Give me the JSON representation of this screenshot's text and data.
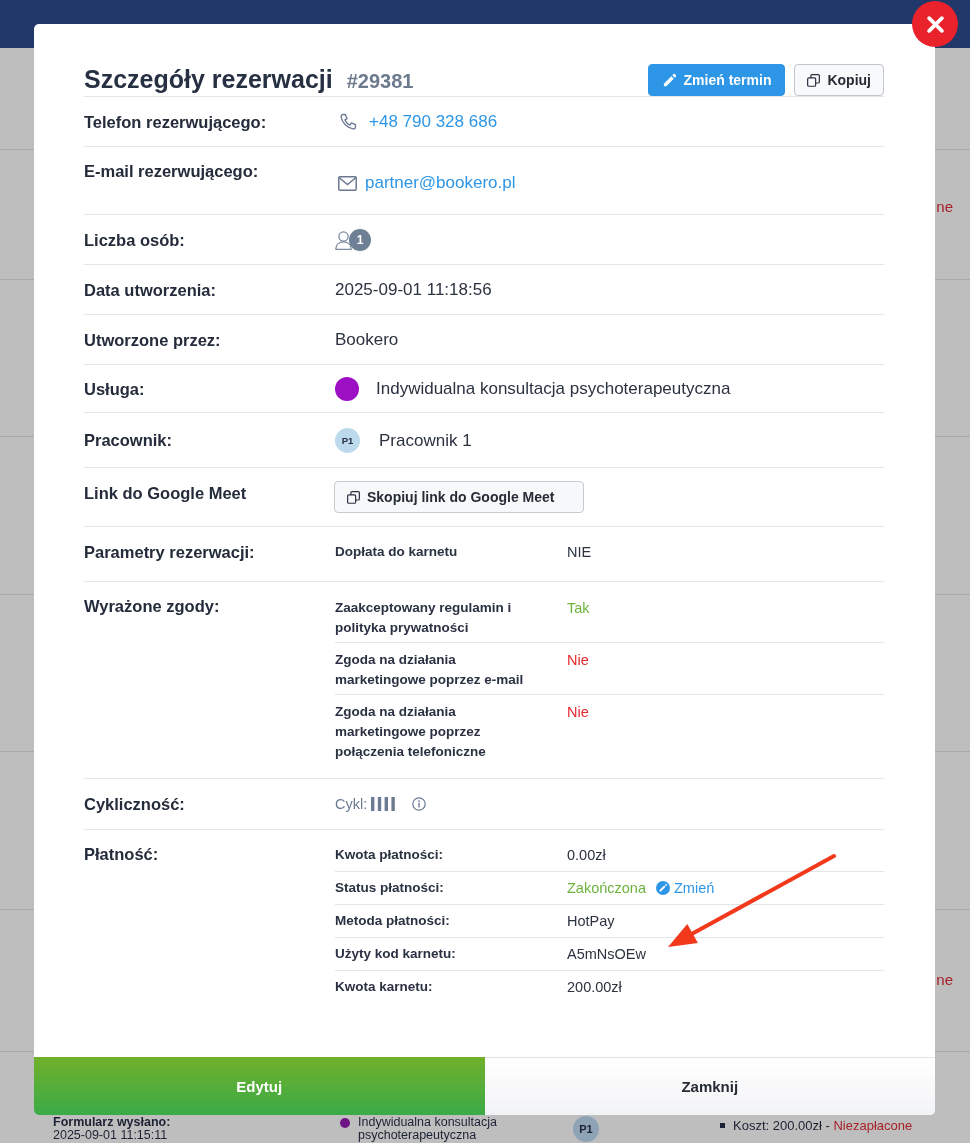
{
  "background_page": {
    "side_fragments": [
      "ne",
      "ne"
    ],
    "bottom_row": {
      "label": "Formularz wysłano:",
      "date": "2025-09-01 11:15:11",
      "service": "Indywidualna konsultacja psychoterapeutyczna",
      "color": "#6e1484",
      "employee": "P1",
      "cost": "Koszt: 200.00zł -",
      "cost_status": "Niezapłacone"
    }
  },
  "modal": {
    "title": "Szczegóły rezerwacji",
    "number": "#29381",
    "header_buttons": [
      {
        "kind": "reschedule",
        "label": "Zmień termin"
      },
      {
        "kind": "copy",
        "label": "Kopiuj"
      }
    ],
    "rows": [
      {
        "kind": "phone",
        "label": "Telefon rezerwującego:",
        "value": "+48 790 328 686"
      },
      {
        "kind": "email",
        "label": "E-mail rezerwującego:",
        "value": "partner@bookero.pl"
      },
      {
        "kind": "people",
        "label": "Liczba osób:",
        "count": "1"
      },
      {
        "kind": "text",
        "label": "Data utworzenia:",
        "value": "2025-09-01 11:18:56"
      },
      {
        "kind": "text",
        "label": "Utworzone przez:",
        "value": "Bookero"
      },
      {
        "kind": "service",
        "label": "Usługa:",
        "value": "Indywidualna konsultacja psychoterapeutyczna",
        "color": "#9c10c4"
      },
      {
        "kind": "employee",
        "label": "Pracownik:",
        "initials": "P1",
        "value": "Pracownik 1"
      },
      {
        "kind": "button",
        "label": "Link do Google Meet",
        "button": "Skopiuj link do Google Meet"
      },
      {
        "kind": "params",
        "label": "Parametry rezerwacji:",
        "items": [
          {
            "name": "Dopłata do karnetu",
            "value": "NIE"
          }
        ]
      },
      {
        "kind": "consents",
        "label": "Wyrażone zgody:",
        "items": [
          {
            "name": "Zaakceptowany regulamin i polityka prywatności",
            "value": "Tak",
            "accepted": true
          },
          {
            "name": "Zgoda na działania marketingowe poprzez e-mail",
            "value": "Nie",
            "accepted": false
          },
          {
            "name": "Zgoda na działania marketingowe poprzez połączenia telefoniczne",
            "value": "Nie",
            "accepted": false
          }
        ]
      },
      {
        "kind": "cycle",
        "label": "Cykliczność:",
        "prefix": "Cykl:"
      },
      {
        "kind": "payment",
        "label": "Płatność:",
        "items": [
          {
            "kind": "text",
            "name": "Kwota płatności:",
            "value": "0.00zł"
          },
          {
            "kind": "status",
            "name": "Status płatności:",
            "value": "Zakończona",
            "completed": true,
            "action": "Zmień"
          },
          {
            "kind": "text",
            "name": "Metoda płatności:",
            "value": "HotPay"
          },
          {
            "kind": "text",
            "name": "Użyty kod karnetu:",
            "value": "A5mNsOEw"
          },
          {
            "kind": "text",
            "name": "Kwota karnetu:",
            "value": "200.00zł"
          }
        ]
      }
    ],
    "footer_buttons": [
      {
        "kind": "edit",
        "label": "Edytuj"
      },
      {
        "kind": "close",
        "label": "Zamknij"
      }
    ]
  }
}
